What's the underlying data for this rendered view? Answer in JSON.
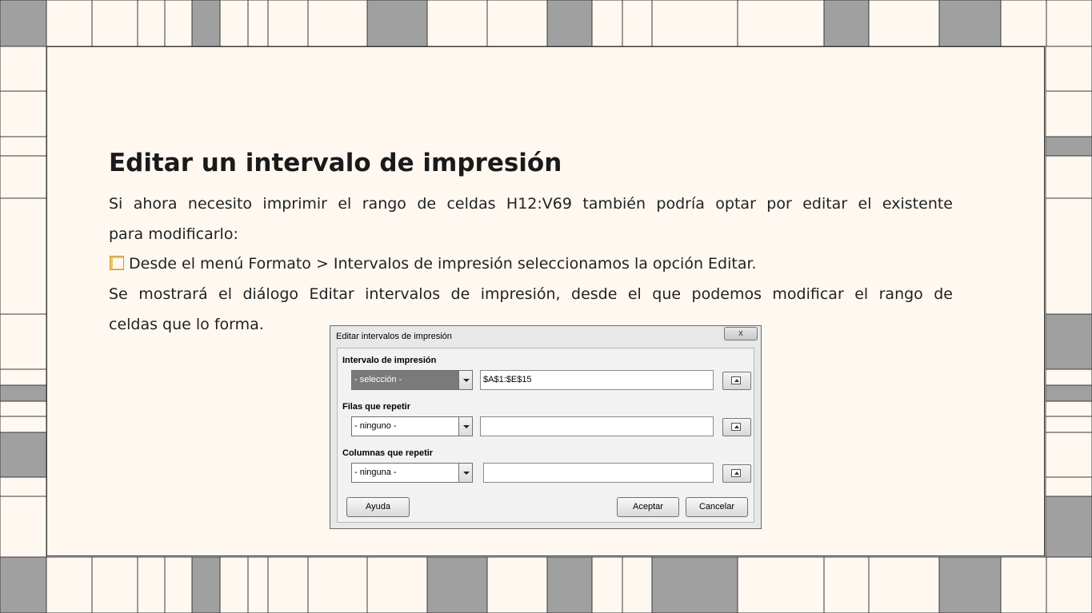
{
  "slide": {
    "title": "Editar un intervalo de impresión",
    "paragraph1_line1": "Si ahora necesito imprimir el rango de celdas H12:V69 también podría optar por editar el existente",
    "paragraph1_line2": "para modificarlo:",
    "bullet": "Desde el menú Formato > Intervalos de impresión seleccionamos la opción Editar.",
    "paragraph2_line1": "Se mostrará el diálogo Editar intervalos de impresión, desde el que podemos modificar el rango de",
    "paragraph2_line2": "celdas que lo forma."
  },
  "dialog": {
    "title": "Editar intervalos de impresión",
    "close_label": "x",
    "print_range_label": "Intervalo de impresión",
    "print_range_combo": "- selección -",
    "print_range_value": "$A$1:$E$15",
    "rows_label": "Filas que repetir",
    "rows_combo": "- ninguno -",
    "rows_value": "",
    "columns_label": "Columnas que repetir",
    "columns_combo": "- ninguna -",
    "columns_value": "",
    "help_button": "Ayuda",
    "ok_button": "Aceptar",
    "cancel_button": "Cancelar"
  },
  "colors": {
    "background": "#fef8f1",
    "tile_gray": "#a0a0a0",
    "grid_line": "#3a3a3a"
  }
}
